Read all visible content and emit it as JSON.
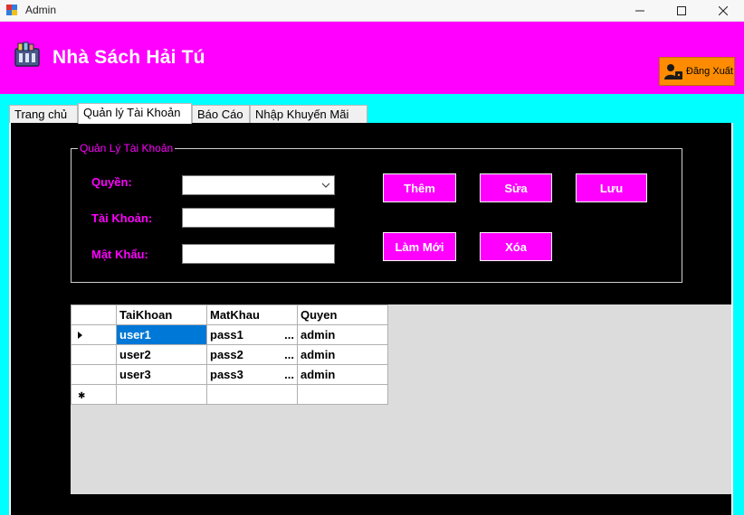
{
  "window": {
    "title": "Admin"
  },
  "header": {
    "title": "Nhà Sách Hải Tú",
    "logout_label": "Đăng Xuất"
  },
  "tabs": [
    {
      "label": "Trang chủ"
    },
    {
      "label": "Quản lý Tài Khoản"
    },
    {
      "label": "Báo Cáo"
    },
    {
      "label": "Nhập Khuyến Mãi"
    }
  ],
  "form": {
    "group_title": "Quản Lý Tài Khoản",
    "role_label": "Quyền:",
    "user_label": "Tài Khoản:",
    "pass_label": "Mật Khẩu:",
    "role_value": "",
    "user_value": "",
    "pass_value": ""
  },
  "buttons": {
    "add": "Thêm",
    "edit": "Sửa",
    "save": "Lưu",
    "reset": "Làm Mới",
    "delete": "Xóa"
  },
  "grid": {
    "columns": [
      "TaiKhoan",
      "MatKhau",
      "Quyen"
    ],
    "rows": [
      [
        "user1",
        "pass1",
        "admin"
      ],
      [
        "user2",
        "pass2",
        "admin"
      ],
      [
        "user3",
        "pass3",
        "admin"
      ]
    ],
    "ellipsis": "..."
  },
  "colors": {
    "header": "#ff00ff",
    "accent": "#00ffff",
    "logout": "#ff8c00",
    "panel": "#000000"
  }
}
